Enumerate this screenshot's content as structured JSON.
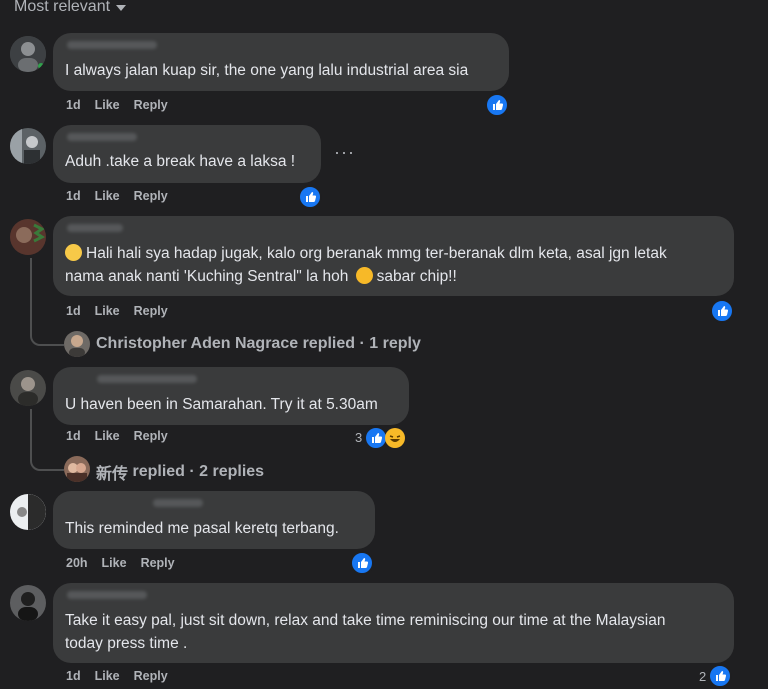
{
  "sort_label": "Most relevant",
  "comments": [
    {
      "text": "I always jalan kuap sir, the one yang lalu industrial area sia",
      "time": "1d",
      "like": "Like",
      "reply": "Reply",
      "reaction_count": ""
    },
    {
      "text": "Aduh .take a break have a laksa !",
      "time": "1d",
      "like": "Like",
      "reply": "Reply",
      "reaction_count": "",
      "more": "···"
    },
    {
      "text_line1": "Hali hali sya hadap jugak, kalo org beranak mmg ter-beranak dlm keta, asal jgn letak",
      "text_line2a": "nama anak nanti 'Kuching Sentral\" la hoh",
      "text_line2b": "sabar chip!!",
      "time": "1d",
      "like": "Like",
      "reply": "Reply",
      "reaction_count": ""
    },
    {
      "text": "U haven been in Samarahan. Try it at 5.30am",
      "time": "1d",
      "like": "Like",
      "reply": "Reply",
      "reaction_count": "3"
    },
    {
      "text": "This reminded me pasal keretq terbang.",
      "time": "20h",
      "like": "Like",
      "reply": "Reply",
      "reaction_count": ""
    },
    {
      "text_line1": "Take it easy pal, just sit down, relax and take time reminiscing our time at the Malaysian",
      "text_line2": "today press time .",
      "time": "1d",
      "like": "Like",
      "reply": "Reply",
      "reaction_count": "2"
    }
  ],
  "replies": [
    {
      "name": "Christopher Aden Nagrace",
      "suffix": "replied · 1 reply"
    },
    {
      "name": "新传",
      "suffix": "replied · 2 replies"
    }
  ],
  "icons": {
    "like": "thumbs-up-icon",
    "haha": "haha-emoji-icon",
    "sad": "pensive-emoji-icon",
    "caret": "caret-down-icon"
  },
  "colors": {
    "background": "#1f1f21",
    "bubble": "#3a3b3c",
    "like_blue": "#1877f2",
    "secondary_text": "#b0b3b8"
  }
}
